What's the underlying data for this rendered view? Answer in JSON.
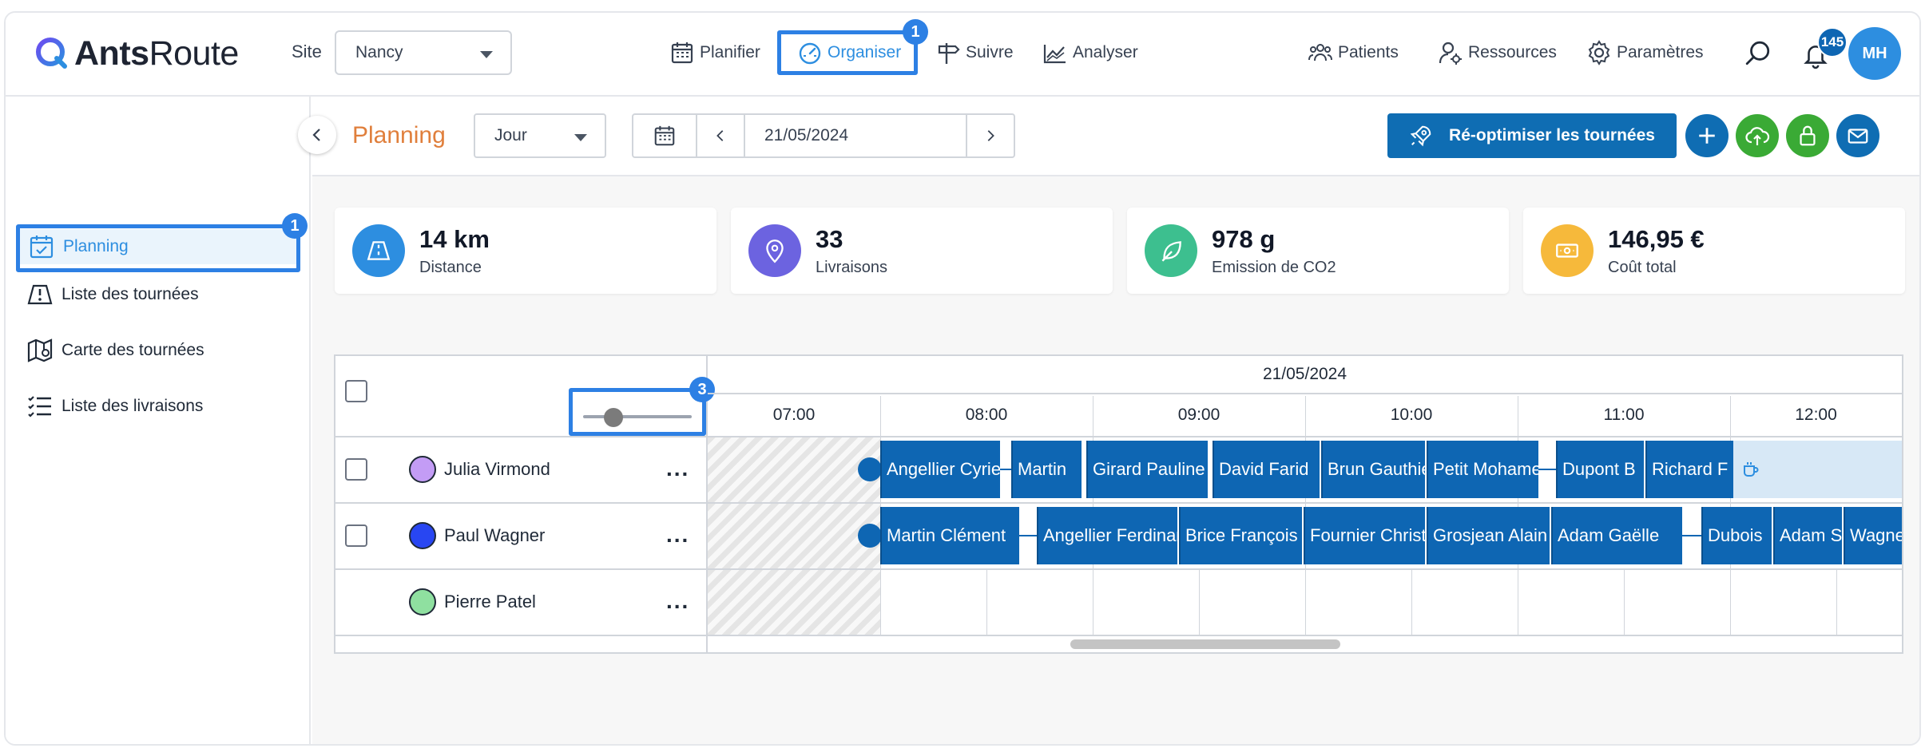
{
  "app": {
    "logo_bold": "Ants",
    "logo_regular": "Route"
  },
  "site": {
    "label": "Site",
    "value": "Nancy"
  },
  "nav": {
    "planifier": "Planifier",
    "organiser": "Organiser",
    "suivre": "Suivre",
    "analyser": "Analyser",
    "patients": "Patients",
    "ressources": "Ressources",
    "parametres": "Paramètres"
  },
  "notifications": {
    "count": "145"
  },
  "user": {
    "initials": "MH"
  },
  "steps": {
    "organiser": "1",
    "sidebar_planning": "1",
    "zoom": "3"
  },
  "sidebar": {
    "items": [
      {
        "label": "Planning",
        "icon": "calendar-check-icon",
        "active": true
      },
      {
        "label": "Liste des tournées",
        "icon": "route-list-icon",
        "active": false
      },
      {
        "label": "Carte des tournées",
        "icon": "map-icon",
        "active": false
      },
      {
        "label": "Liste des livraisons",
        "icon": "checklist-icon",
        "active": false
      }
    ]
  },
  "header": {
    "title": "Planning",
    "view": "Jour",
    "date": "21/05/2024",
    "reoptimize_label": "Ré-optimiser les tournées"
  },
  "stats": [
    {
      "value": "14 km",
      "label": "Distance",
      "color": "#2d8ee0",
      "icon": "road-icon"
    },
    {
      "value": "33",
      "label": "Livraisons",
      "color": "#6c63e0",
      "icon": "pin-icon"
    },
    {
      "value": "978 g",
      "label": "Emission de CO2",
      "color": "#3dbf8f",
      "icon": "leaf-icon"
    },
    {
      "value": "146,95 €",
      "label": "Coût total",
      "color": "#f6b93b",
      "icon": "money-icon"
    }
  ],
  "timeline": {
    "date": "21/05/2024",
    "hours": [
      "07:00",
      "08:00",
      "09:00",
      "10:00",
      "11:00",
      "12:00"
    ],
    "resources": [
      {
        "name": "Julia Virmond",
        "color": "#c39cf5",
        "has_checkbox": true
      },
      {
        "name": "Paul Wagner",
        "color": "#2846f2",
        "has_checkbox": true
      },
      {
        "name": "Pierre Patel",
        "color": "#8fe0a0",
        "has_checkbox": false
      }
    ],
    "tasks_row1": [
      "Angellier Cyrielle",
      "Martin",
      "Girard Pauline",
      "David Farid",
      "Brun Gauthier",
      "Petit Mohamed",
      "Dupont B",
      "Richard F"
    ],
    "tasks_row2": [
      "Martin Clément",
      "Angellier Ferdinand",
      "Brice François",
      "Fournier Christine",
      "Grosjean Alain",
      "Adam Gaëlle",
      "Dubois",
      "Adam S",
      "Wagner"
    ]
  },
  "colors": {
    "accent": "#2d8ee0",
    "task": "#0e66b3",
    "title": "#e07f3c",
    "green": "#3aaa35"
  }
}
